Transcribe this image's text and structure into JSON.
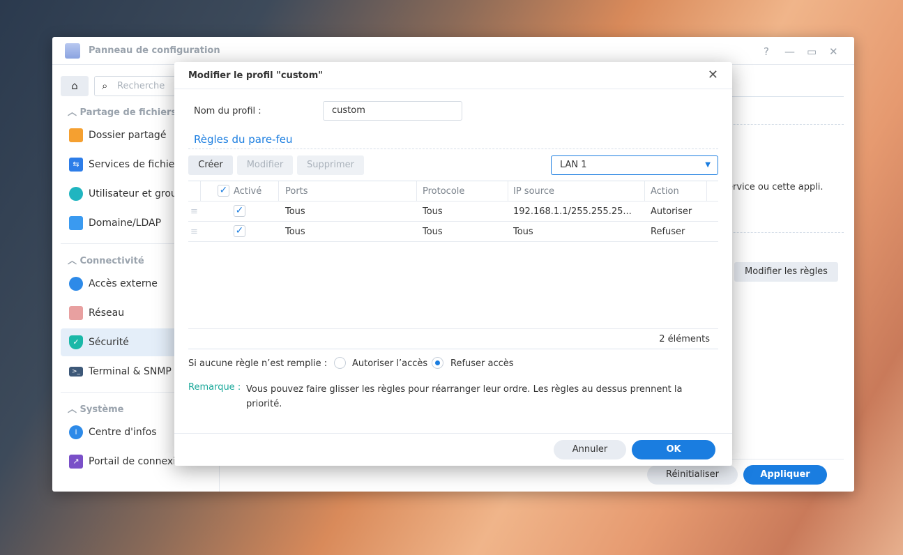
{
  "window": {
    "title": "Panneau de configuration",
    "help": "?",
    "minimize": "—",
    "maximize": "▭",
    "close": "✕"
  },
  "sidebar": {
    "search_placeholder": "Recherche",
    "sections": [
      {
        "label": "Partage de fichiers",
        "items": [
          "Dossier partagé",
          "Services de fichiers",
          "Utilisateur et groupe",
          "Domaine/LDAP"
        ]
      },
      {
        "label": "Connectivité",
        "items": [
          "Accès externe",
          "Réseau",
          "Sécurité",
          "Terminal & SNMP"
        ]
      },
      {
        "label": "Système",
        "items": [
          "Centre d'infos",
          "Portail de connexion"
        ]
      }
    ],
    "active": "Sécurité"
  },
  "main": {
    "partial_text": "ervice ou cette appli.",
    "edit_rules": "Modifier les règles",
    "reset": "Réinitialiser",
    "apply": "Appliquer"
  },
  "dialog": {
    "title": "Modifier le profil \"custom\"",
    "close": "✕",
    "profile_label": "Nom du profil :",
    "profile_value": "custom",
    "rules_heading": "Règles du pare-feu",
    "toolbar": {
      "create": "Créer",
      "edit": "Modifier",
      "delete": "Supprimer"
    },
    "interface": "LAN 1",
    "columns": [
      "Activé",
      "Ports",
      "Protocole",
      "IP source",
      "Action"
    ],
    "rows": [
      {
        "enabled": true,
        "ports": "Tous",
        "protocol": "Tous",
        "source": "192.168.1.1/255.255.25...",
        "action": "Autoriser"
      },
      {
        "enabled": true,
        "ports": "Tous",
        "protocol": "Tous",
        "source": "Tous",
        "action": "Refuser"
      }
    ],
    "count": "2 éléments",
    "default_label": "Si aucune règle n’est remplie :",
    "opt_allow": "Autoriser l’accès",
    "opt_deny": "Refuser accès",
    "default_selected": "deny",
    "note_label": "Remarque :",
    "note_text": "Vous pouvez faire glisser les règles pour réarranger leur ordre. Les règles au dessus prennent la priorité.",
    "cancel": "Annuler",
    "ok": "OK"
  },
  "colors": {
    "accent": "#1a7de0",
    "teal": "#1aa89a"
  }
}
